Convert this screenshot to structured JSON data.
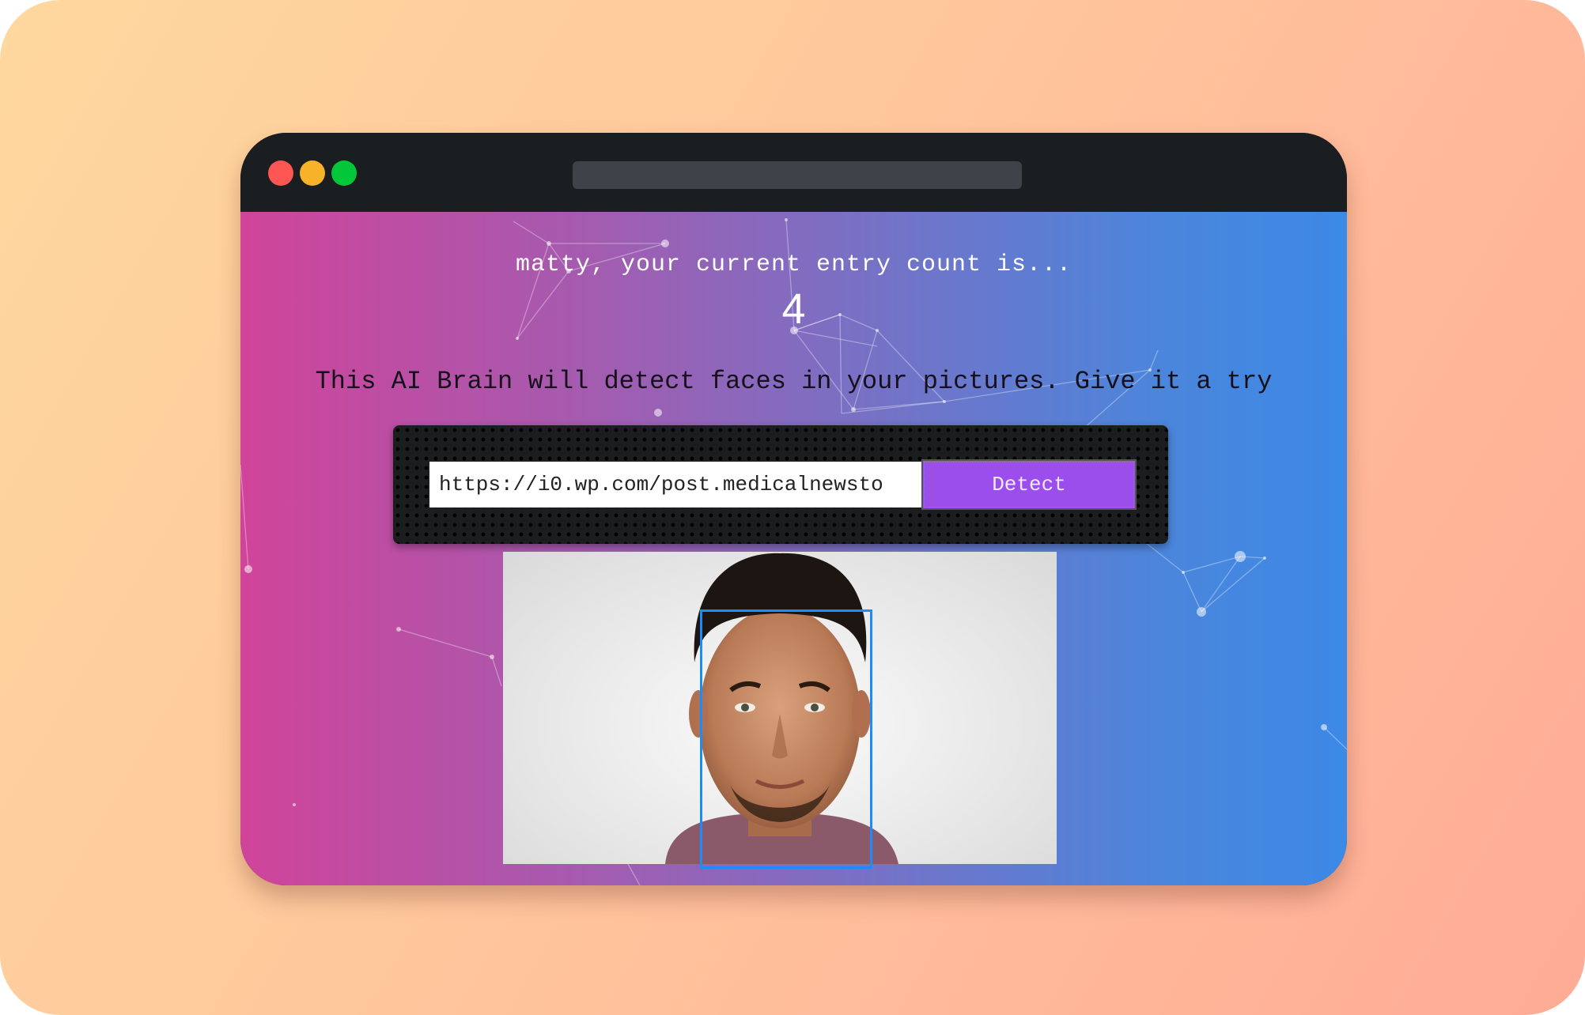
{
  "window": {
    "traffic_lights": [
      "close",
      "minimize",
      "zoom"
    ],
    "colors": {
      "close": "#fe5652",
      "minimize": "#f7b22a",
      "zoom": "#02c839"
    }
  },
  "page": {
    "greeting": "matty, your current entry count is...",
    "entry_count": "4",
    "tagline": "This AI Brain will detect faces in your pictures. Give it a try",
    "gradient_colors": [
      "#d0449a",
      "#3c89e6"
    ]
  },
  "form": {
    "url_value": "https://i0.wp.com/post.medicalnewsto",
    "detect_label": "Detect",
    "button_color": "#9b4eec"
  },
  "result": {
    "image": "portrait-photo",
    "face_box_color": "#1d8cf8"
  }
}
